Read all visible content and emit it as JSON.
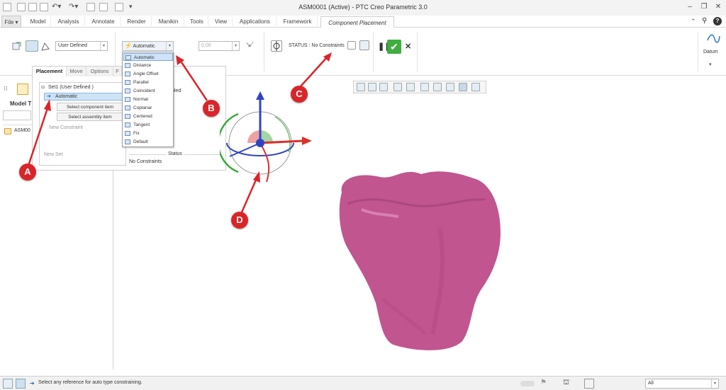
{
  "app": {
    "title": "ASM0001 (Active) - PTC Creo Parametric 3.0"
  },
  "menu": {
    "file": "File ▾",
    "items": [
      "Model",
      "Analysis",
      "Annotate",
      "Render",
      "Manikin",
      "Tools",
      "View",
      "Applications",
      "Framework"
    ],
    "active_tab": "Component Placement"
  },
  "ribbon": {
    "user_defined": "User Defined",
    "constraint_type": "Automatic",
    "offset_value": "0.00",
    "status": "STATUS : No Constraints",
    "datum_label": "Datum"
  },
  "constraint_menu": {
    "items": [
      "Automatic",
      "Distance",
      "Angle Offset",
      "Parallel",
      "Coincident",
      "Normal",
      "Coplanar",
      "Centered",
      "Tangent",
      "Fix",
      "Default"
    ],
    "selected": "Automatic"
  },
  "placement_panel": {
    "tabs": [
      "Placement",
      "Move",
      "Options",
      "F"
    ],
    "set_label": "Set1 (User Defined )",
    "constraint_item": "Automatic",
    "select_component": "Select component item",
    "select_assembly": "Select assembly item",
    "new_constraint": "New Constraint",
    "new_set": "New Set",
    "enabled_partial": "bled",
    "status_header": "Status",
    "status_value": "No Constraints"
  },
  "model_tree": {
    "title": "Model T",
    "root": "ASM00"
  },
  "statusbar": {
    "message": "Select any reference for auto type constraining.",
    "filter": "All"
  },
  "callouts": [
    "A",
    "B",
    "C",
    "D"
  ],
  "colors": {
    "part": "#c1558f",
    "callout": "#d9252a",
    "accept": "#3fae3f",
    "axis_x": "#d8322b",
    "axis_y": "#2f44c4",
    "axis_z": "#3aa83a"
  }
}
